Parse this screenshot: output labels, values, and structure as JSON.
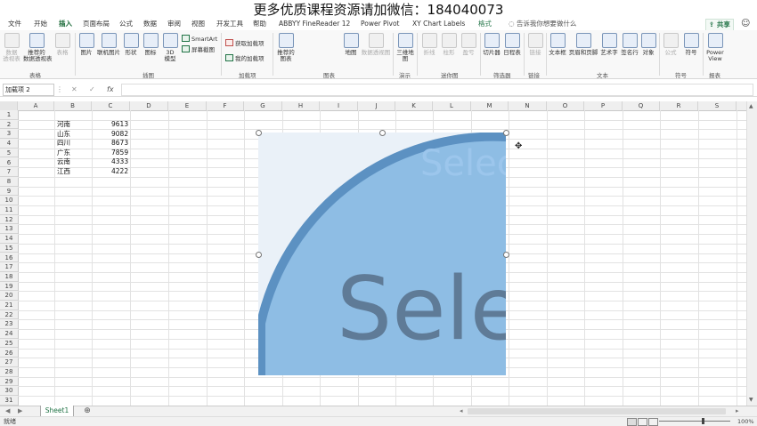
{
  "banner": {
    "text": "更多优质课程资源请加微信：184040073"
  },
  "tabs": [
    {
      "label": "文件"
    },
    {
      "label": "开始"
    },
    {
      "label": "插入"
    },
    {
      "label": "页面布局"
    },
    {
      "label": "公式"
    },
    {
      "label": "数据"
    },
    {
      "label": "审阅"
    },
    {
      "label": "视图"
    },
    {
      "label": "开发工具"
    },
    {
      "label": "帮助"
    },
    {
      "label": "ABBYY FineReader 12"
    },
    {
      "label": "Power Pivot"
    },
    {
      "label": "XY Chart Labels"
    },
    {
      "label": "格式"
    }
  ],
  "active_tab": "插入",
  "tellme": "告诉我你想要做什么",
  "share": "共享",
  "ribbon": {
    "buttons": [
      {
        "label": "数据\n透视表"
      },
      {
        "label": "推荐的\n数据透视表"
      },
      {
        "label": "表格"
      },
      {
        "label": "图片"
      },
      {
        "label": "联机图片"
      },
      {
        "label": "形状"
      },
      {
        "label": "图标"
      },
      {
        "label": "3D\n模型"
      },
      {
        "label": "推荐的\n图表"
      },
      {
        "label": "地图"
      },
      {
        "label": "数据透视图"
      },
      {
        "label": "三维地\n图"
      },
      {
        "label": "折线"
      },
      {
        "label": "柱形"
      },
      {
        "label": "盈亏"
      },
      {
        "label": "切片器"
      },
      {
        "label": "日程表"
      },
      {
        "label": "链接"
      },
      {
        "label": "文本框"
      },
      {
        "label": "页眉和页脚"
      },
      {
        "label": "艺术字"
      },
      {
        "label": "签名行"
      },
      {
        "label": "对象"
      },
      {
        "label": "公式"
      },
      {
        "label": "符号"
      },
      {
        "label": "Power\nView"
      }
    ],
    "small": {
      "smartart": "SmartArt",
      "screenshot": "屏幕截图",
      "get_addins": "获取加载项",
      "my_addins": "我的加载项"
    },
    "groups": [
      {
        "label": "表格"
      },
      {
        "label": "插图"
      },
      {
        "label": "加载项"
      },
      {
        "label": "图表"
      },
      {
        "label": "演示"
      },
      {
        "label": "迷你图"
      },
      {
        "label": "筛选器"
      },
      {
        "label": "链接"
      },
      {
        "label": "文本"
      },
      {
        "label": "符号"
      },
      {
        "label": "报表"
      }
    ]
  },
  "formula_bar": {
    "name_box": "加载项 2",
    "formula": ""
  },
  "columns": [
    "A",
    "B",
    "C",
    "D",
    "E",
    "F",
    "G",
    "H",
    "I",
    "J",
    "K",
    "L",
    "M",
    "N",
    "O",
    "P",
    "Q",
    "R",
    "S"
  ],
  "rows": [
    "1",
    "2",
    "3",
    "4",
    "5",
    "6",
    "7",
    "8",
    "9",
    "10",
    "11",
    "12",
    "13",
    "14",
    "15",
    "16",
    "17",
    "18",
    "19",
    "20",
    "21",
    "22",
    "23",
    "24",
    "25",
    "26",
    "27",
    "28",
    "29",
    "30",
    "31"
  ],
  "table": [
    {
      "province": "河南",
      "value": "9613"
    },
    {
      "province": "山东",
      "value": "9082"
    },
    {
      "province": "四川",
      "value": "8673"
    },
    {
      "province": "广东",
      "value": "7859"
    },
    {
      "province": "云南",
      "value": "4333"
    },
    {
      "province": "江西",
      "value": "4222"
    }
  ],
  "picture": {
    "text_main": "Sele",
    "text_faded": "Selec",
    "color_fill": "#8ebde4",
    "color_band": "#5c91c2",
    "color_text": "#5f7b97",
    "color_faded_text": "#9cc6ec",
    "color_bg": "#eaf1f8"
  },
  "sheet_tab": "Sheet1",
  "status": {
    "ready": "就绪",
    "zoom": "100%"
  },
  "accent": "#217346"
}
